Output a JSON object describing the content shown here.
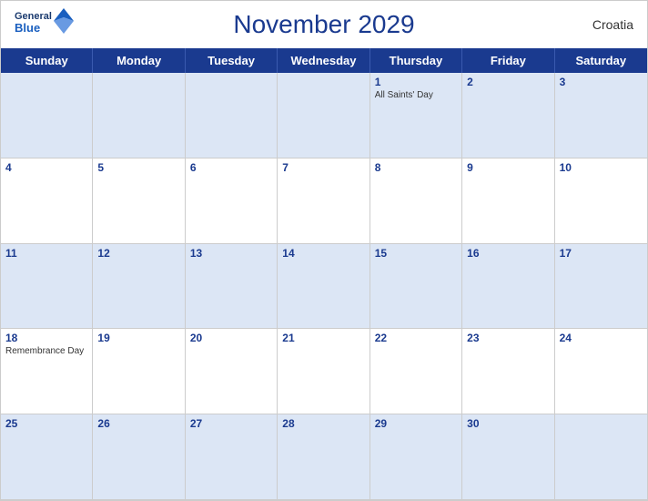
{
  "header": {
    "title": "November 2029",
    "country": "Croatia"
  },
  "logo": {
    "general": "General",
    "blue": "Blue"
  },
  "day_headers": [
    "Sunday",
    "Monday",
    "Tuesday",
    "Wednesday",
    "Thursday",
    "Friday",
    "Saturday"
  ],
  "weeks": [
    [
      {
        "day": null
      },
      {
        "day": null
      },
      {
        "day": null
      },
      {
        "day": null
      },
      {
        "day": 1,
        "holiday": "All Saints' Day"
      },
      {
        "day": 2
      },
      {
        "day": 3
      }
    ],
    [
      {
        "day": 4
      },
      {
        "day": 5
      },
      {
        "day": 6
      },
      {
        "day": 7
      },
      {
        "day": 8
      },
      {
        "day": 9
      },
      {
        "day": 10
      }
    ],
    [
      {
        "day": 11
      },
      {
        "day": 12
      },
      {
        "day": 13
      },
      {
        "day": 14
      },
      {
        "day": 15
      },
      {
        "day": 16
      },
      {
        "day": 17
      }
    ],
    [
      {
        "day": 18,
        "holiday": "Remembrance Day"
      },
      {
        "day": 19
      },
      {
        "day": 20
      },
      {
        "day": 21
      },
      {
        "day": 22
      },
      {
        "day": 23
      },
      {
        "day": 24
      }
    ],
    [
      {
        "day": 25
      },
      {
        "day": 26
      },
      {
        "day": 27
      },
      {
        "day": 28
      },
      {
        "day": 29
      },
      {
        "day": 30
      },
      {
        "day": null
      }
    ]
  ],
  "colors": {
    "header_bg": "#1a3a8f",
    "row_shaded": "#dce6f5",
    "row_white": "#ffffff",
    "text_blue": "#1a3a8f",
    "text_dark": "#333333"
  }
}
